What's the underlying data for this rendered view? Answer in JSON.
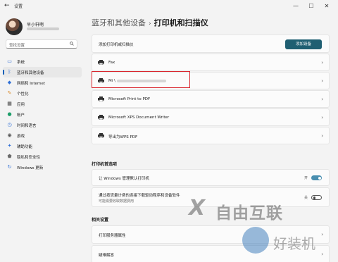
{
  "window": {
    "title": "设置",
    "controls": {
      "minimize": "—",
      "maximize": "☐",
      "close": "✕"
    }
  },
  "profile": {
    "name": "早小轩啊"
  },
  "search": {
    "placeholder": "查找设置"
  },
  "nav": [
    {
      "label": "系统",
      "icon": "display-icon",
      "color": "#2f6fd6"
    },
    {
      "label": "蓝牙和其他设备",
      "icon": "bluetooth-icon",
      "color": "#2f6fd6",
      "active": true
    },
    {
      "label": "网络和 Internet",
      "icon": "wifi-icon",
      "color": "#2f6fd6"
    },
    {
      "label": "个性化",
      "icon": "brush-icon",
      "color": "#d98a2a"
    },
    {
      "label": "应用",
      "icon": "apps-icon",
      "color": "#444444"
    },
    {
      "label": "帐户",
      "icon": "person-icon",
      "color": "#1e9e6a"
    },
    {
      "label": "时间和语言",
      "icon": "globe-clock-icon",
      "color": "#2f6fd6"
    },
    {
      "label": "游戏",
      "icon": "gamepad-icon",
      "color": "#555555"
    },
    {
      "label": "辅助功能",
      "icon": "accessibility-icon",
      "color": "#2f6fd6"
    },
    {
      "label": "隐私和安全性",
      "icon": "shield-icon",
      "color": "#6a6a6a"
    },
    {
      "label": "Windows 更新",
      "icon": "update-icon",
      "color": "#2f6fd6"
    }
  ],
  "breadcrumb": {
    "parent": "蓝牙和其他设备",
    "separator": "›",
    "current": "打印机和扫描仪"
  },
  "add_printer": {
    "label": "添加打印机或扫描仪",
    "button": "添加设备"
  },
  "printers": [
    {
      "name": "Fax"
    },
    {
      "name": "Mi \\",
      "highlighted": true
    },
    {
      "name": "Microsoft Print to PDF"
    },
    {
      "name": "Microsoft XPS Document Writer"
    },
    {
      "name": "导出为WPS PDF"
    }
  ],
  "preferences": {
    "title": "打印机首选项",
    "default_printer": {
      "label": "让 Windows 管理默认打印机",
      "state": "开"
    },
    "metered": {
      "label": "通过按流量计费的连接下载驱动程序和设备软件",
      "sub": "可能需要收取数据费用",
      "state": "关"
    }
  },
  "related": {
    "title": "相关设置",
    "items": [
      "打印服务器属性",
      "疑难解答"
    ]
  },
  "watermark": {
    "mark": "X",
    "brand": "自由互联",
    "site": "好装机"
  },
  "colors": {
    "accent": "#005fb8",
    "button": "#1f5f72",
    "highlight": "#d9262e"
  }
}
